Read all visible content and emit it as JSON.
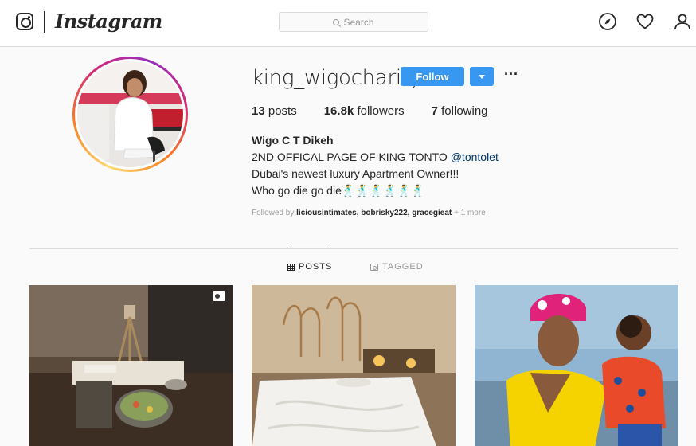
{
  "nav": {
    "brand": "Instagram",
    "search_placeholder": "Search",
    "icons": [
      "explore-compass-icon",
      "activity-heart-icon",
      "profile-person-icon"
    ]
  },
  "profile": {
    "username": "king_wigocharity",
    "follow_label": "Follow",
    "stats": {
      "posts_count": "13",
      "posts_label": "posts",
      "followers_count": "16.8k",
      "followers_label": "followers",
      "following_count": "7",
      "following_label": "following"
    },
    "bio": {
      "full_name": "Wigo C T Dikeh",
      "line1": "2ND OFFICAL PAGE OF KING TONTO ",
      "line1_mention": "@tontolet",
      "line2": "Dubai's newest luxury Apartment Owner!!!",
      "line3": "Who go die go die🕺🕺🕺🕺🕺🕺"
    },
    "followed_by": {
      "prefix": "Followed by ",
      "names": "liciousintimates, bobrisky222, gracegieat",
      "more": " + 1 more"
    }
  },
  "tabs": {
    "posts": "POSTS",
    "tagged": "TAGGED"
  },
  "colors": {
    "accent": "#3897f0",
    "border": "#dbdbdb",
    "background": "#fafafa",
    "text": "#262626",
    "muted": "#999999",
    "link": "#003569"
  }
}
